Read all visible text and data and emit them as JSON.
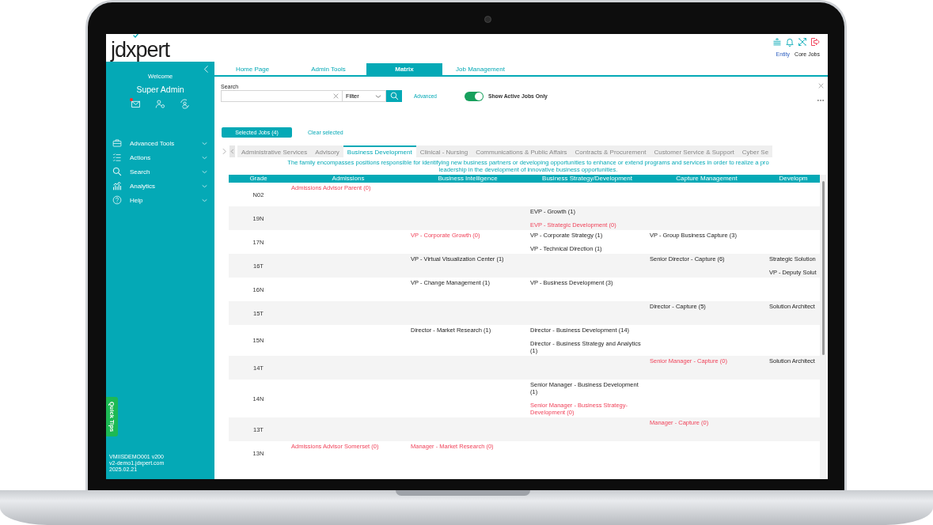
{
  "header": {
    "logo": "jdxpert",
    "links": [
      {
        "label": "Entity",
        "kind": "link"
      },
      {
        "label": "Core Jobs",
        "kind": "text"
      }
    ]
  },
  "sidebar": {
    "welcome": "Welcome",
    "user": "Super Admin",
    "has_unread_mail": true,
    "menu": [
      {
        "label": "Advanced Tools"
      },
      {
        "label": "Actions"
      },
      {
        "label": "Search"
      },
      {
        "label": "Analytics"
      },
      {
        "label": "Help"
      }
    ],
    "quick_tips": "Quick Tips",
    "footer": [
      "VMIISDEMO001 v200",
      "v2-demo1.jdxpert.com",
      "2025.02.21"
    ]
  },
  "tabs": [
    {
      "label": "Home Page",
      "selected": false
    },
    {
      "label": "Admin Tools",
      "selected": false
    },
    {
      "label": "Matrix",
      "selected": true
    },
    {
      "label": "Job Management",
      "selected": false
    }
  ],
  "search": {
    "label": "Search",
    "filter": "Filter",
    "advanced": "Advanced",
    "active_only": {
      "label": "Show Active Jobs Only",
      "on": true
    }
  },
  "selected_jobs": "Selected Jobs (4)",
  "clear_selected": "Clear selected",
  "families": [
    {
      "label": "Administrative Services",
      "selected": false
    },
    {
      "label": "Advisory",
      "selected": false
    },
    {
      "label": "Business Development",
      "selected": true
    },
    {
      "label": "Clinical - Nursing",
      "selected": false
    },
    {
      "label": "Communications & Public Affairs",
      "selected": false
    },
    {
      "label": "Contracts & Procurement",
      "selected": false
    },
    {
      "label": "Customer Service & Support",
      "selected": false
    },
    {
      "label": "Cyber Se",
      "selected": false
    }
  ],
  "family_description": [
    "The family encompasses positions responsible for identifying new business partners or developing opportunities to enhance or extend programs and services in order to realize a pro",
    "leadership in the development of innovative business opportunities."
  ],
  "matrix": {
    "grade_header": "Grade",
    "columns": [
      "Admissions",
      "Business Intelligence",
      "Business Strategy/Development",
      "Capture Management",
      "Developm"
    ],
    "rows": [
      {
        "grade": "N02",
        "cells": [
          [
            {
              "title": "Admissions Advisor Parent (0)",
              "unfilled": true
            }
          ],
          [],
          [],
          [],
          []
        ]
      },
      {
        "grade": "19N",
        "cells": [
          [],
          [],
          [
            {
              "title": "EVP - Growth (1)",
              "unfilled": false
            },
            {
              "title": "EVP - Strategic Development (0)",
              "unfilled": true
            }
          ],
          [],
          []
        ]
      },
      {
        "grade": "17N",
        "cells": [
          [],
          [
            {
              "title": "VP - Corporate Growth (0)",
              "unfilled": true
            }
          ],
          [
            {
              "title": "VP - Corporate Strategy (1)",
              "unfilled": false
            },
            {
              "title": "VP - Technical Direction (1)",
              "unfilled": false
            }
          ],
          [
            {
              "title": "VP - Group Business Capture (3)",
              "unfilled": false
            }
          ],
          []
        ]
      },
      {
        "grade": "16T",
        "cells": [
          [],
          [
            {
              "title": "VP - Virtual Visualization Center (1)",
              "unfilled": false
            }
          ],
          [],
          [
            {
              "title": "Senior Director - Capture (6)",
              "unfilled": false
            }
          ],
          [
            {
              "title": "Strategic Solution",
              "unfilled": false
            },
            {
              "title": "VP - Deputy Solut",
              "unfilled": false
            }
          ]
        ]
      },
      {
        "grade": "16N",
        "cells": [
          [],
          [
            {
              "title": "VP - Change Management (1)",
              "unfilled": false
            }
          ],
          [
            {
              "title": "VP - Business Development (3)",
              "unfilled": false
            }
          ],
          [],
          []
        ]
      },
      {
        "grade": "15T",
        "cells": [
          [],
          [],
          [],
          [
            {
              "title": "Director - Capture (5)",
              "unfilled": false
            }
          ],
          [
            {
              "title": "Solution Architect",
              "unfilled": false
            }
          ]
        ]
      },
      {
        "grade": "15N",
        "cells": [
          [],
          [
            {
              "title": "Director - Market Research (1)",
              "unfilled": false
            }
          ],
          [
            {
              "title": "Director - Business Development (14)",
              "unfilled": false
            },
            {
              "title": "Director - Business Strategy and Analytics (1)",
              "unfilled": false
            }
          ],
          [],
          []
        ]
      },
      {
        "grade": "14T",
        "cells": [
          [],
          [],
          [],
          [
            {
              "title": "Senior Manager - Capture (0)",
              "unfilled": true
            }
          ],
          [
            {
              "title": "Solution Architect",
              "unfilled": false
            }
          ]
        ]
      },
      {
        "grade": "14N",
        "cells": [
          [],
          [],
          [
            {
              "title": "Senior Manager - Business Development (1)",
              "unfilled": false
            },
            {
              "title": "Senior Manager - Business Strategy-Development (0)",
              "unfilled": true
            }
          ],
          [],
          []
        ]
      },
      {
        "grade": "13T",
        "cells": [
          [],
          [],
          [],
          [
            {
              "title": "Manager - Capture (0)",
              "unfilled": true
            }
          ],
          []
        ]
      },
      {
        "grade": "13N",
        "cells": [
          [
            {
              "title": "Admissions Advisor Somerset (0)",
              "unfilled": true
            }
          ],
          [
            {
              "title": "Manager - Market Research (0)",
              "unfilled": true
            }
          ],
          [],
          [],
          []
        ]
      }
    ]
  }
}
